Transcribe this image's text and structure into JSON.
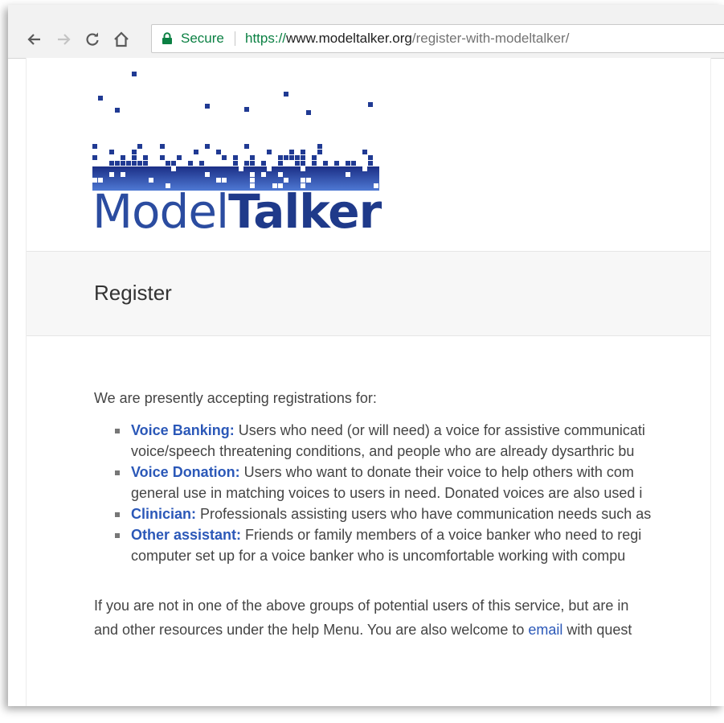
{
  "browser": {
    "back_label": "Back",
    "forward_label": "Forward",
    "reload_label": "Reload",
    "home_label": "Home",
    "security_label": "Secure",
    "url_scheme": "https://",
    "url_host": "www.modeltalker.org",
    "url_path": "/register-with-modeltalker/"
  },
  "logo": {
    "text_light": "Model",
    "text_bold": "Talker"
  },
  "page": {
    "title": "Register",
    "intro": "We are presently accepting registrations for:",
    "items": [
      {
        "term": "Voice Banking:",
        "line1": " Users who need (or will need) a voice for assistive communicati",
        "line2": "voice/speech threatening conditions, and people who are already dysarthric bu"
      },
      {
        "term": "Voice Donation:",
        "line1": " Users who want to donate their voice to help others with com",
        "line2": "general use in matching voices to users in need. Donated voices are also used i"
      },
      {
        "term": "Clinician:",
        "line1": " Professionals assisting users who have communication needs such as"
      },
      {
        "term": "Other assistant:",
        "line1": " Friends or family members of a voice banker who need to regi",
        "line2": "computer set up for a voice banker who is uncomfortable working with compu"
      }
    ],
    "outro_line1": "If you are not in one of the above groups of potential users of this service, but are in",
    "outro_line2_before": "and other resources under the help Menu. You are also welcome to ",
    "outro_link": "email",
    "outro_line2_after": " with quest"
  },
  "colors": {
    "logo_blue": "#2b4ca0",
    "link_blue": "#2b58b8",
    "secure_green": "#0b8043"
  }
}
